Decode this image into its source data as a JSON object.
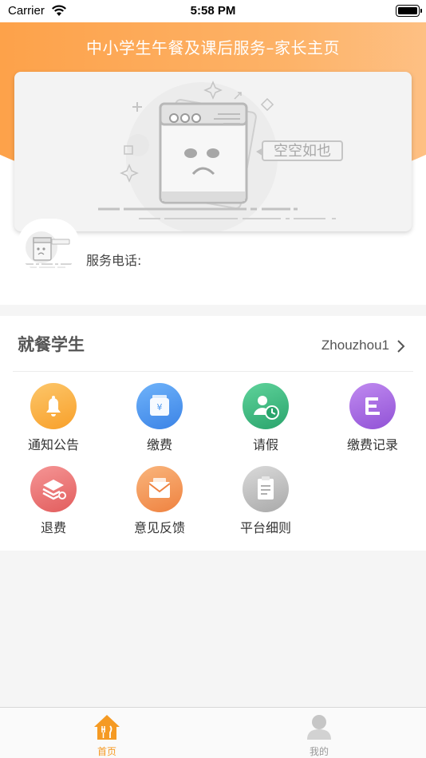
{
  "status_bar": {
    "carrier": "Carrier",
    "time": "5:58 PM"
  },
  "header": {
    "title": "中小学生午餐及课后服务–家长主页"
  },
  "banner": {
    "empty_text": "空空如也"
  },
  "school": {
    "service_phone_label": "服务电话:"
  },
  "student": {
    "section_title": "就餐学生",
    "name": "Zhouzhou1"
  },
  "menu": [
    {
      "label": "通知公告",
      "icon": "bell-icon",
      "color": "#fbb041"
    },
    {
      "label": "缴费",
      "icon": "wallet-icon",
      "color": "#4a96f0"
    },
    {
      "label": "请假",
      "icon": "user-clock-icon",
      "color": "#38b07a"
    },
    {
      "label": "缴费记录",
      "icon": "record-icon",
      "color": "#a460dc"
    },
    {
      "label": "退费",
      "icon": "layers-icon",
      "color": "#ea7272"
    },
    {
      "label": "意见反馈",
      "icon": "feedback-icon",
      "color": "#f39a54"
    },
    {
      "label": "平台细则",
      "icon": "clipboard-icon",
      "color": "#b8b8b8"
    }
  ],
  "tab_bar": {
    "tabs": [
      {
        "label": "首页",
        "icon": "home-icon",
        "active": true,
        "color": "#f59a23"
      },
      {
        "label": "我的",
        "icon": "user-icon",
        "active": false,
        "color": "#999999"
      }
    ]
  }
}
